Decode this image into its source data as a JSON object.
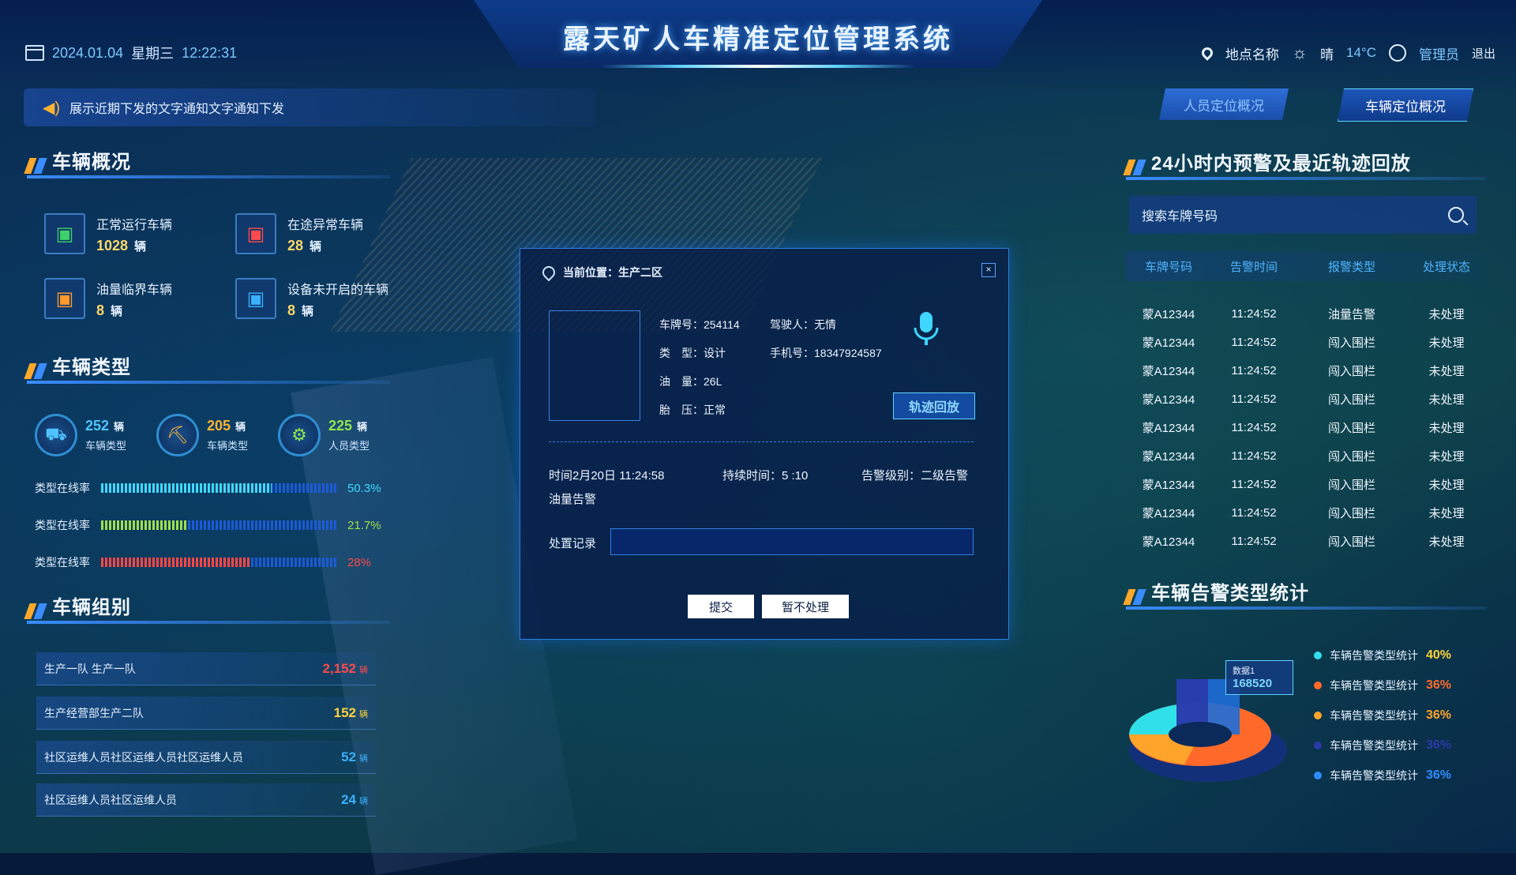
{
  "header": {
    "title": "露天矿人车精准定位管理系统",
    "date": "2024.01.04",
    "weekday": "星期三",
    "time": "12:22:31",
    "location": "地点名称",
    "weather": "晴",
    "temperature": "14°C",
    "user": "管理员",
    "logout": "退出"
  },
  "notice": {
    "text": "展示近期下发的文字通知文字通知下发"
  },
  "tabs": [
    {
      "label": "人员定位概况",
      "active": false
    },
    {
      "label": "车辆定位概况",
      "active": true
    }
  ],
  "overview": {
    "title": "车辆概况",
    "items": [
      {
        "label": "正常运行车辆",
        "value": "1028",
        "unit": "辆",
        "icon": "bus-green-icon",
        "color": "#3fd06a"
      },
      {
        "label": "在途异常车辆",
        "value": "28",
        "unit": "辆",
        "icon": "bus-red-icon",
        "color": "#ff4b4b"
      },
      {
        "label": "油量临界车辆",
        "value": "8",
        "unit": "辆",
        "icon": "bus-orange-icon",
        "color": "#ff9a2a"
      },
      {
        "label": "设备未开启的车辆",
        "value": "8",
        "unit": "辆",
        "icon": "bus-blue-icon",
        "color": "#3ab0ff"
      }
    ]
  },
  "types": {
    "title": "车辆类型",
    "items": [
      {
        "value": "252",
        "unit": "辆",
        "label": "车辆类型",
        "icon": "forklift-icon",
        "color": "#4fc3ff"
      },
      {
        "value": "205",
        "unit": "辆",
        "label": "车辆类型",
        "icon": "excavator-icon",
        "color": "#ffb432"
      },
      {
        "value": "225",
        "unit": "辆",
        "label": "人员类型",
        "icon": "loader-icon",
        "color": "#8fe64a"
      }
    ],
    "rates": [
      {
        "label": "类型在线率",
        "value": "50.3%",
        "pct": 0.724,
        "color": "#40d8ff"
      },
      {
        "label": "类型在线率",
        "value": "21.7%",
        "pct": 0.362,
        "color": "#9fe04a"
      },
      {
        "label": "类型在线率",
        "value": "28%",
        "pct": 0.638,
        "color": "#ff4646"
      }
    ]
  },
  "groups": {
    "title": "车辆组别",
    "unit": "辆",
    "items": [
      {
        "name": "生产一队 生产一队",
        "value": "2,152",
        "color": "#ff4b4b"
      },
      {
        "name": "生产经营部生产二队",
        "value": "152",
        "color": "#ffd23a"
      },
      {
        "name": "社区运维人员社区运维人员社区运维人员",
        "value": "52",
        "color": "#3ab0ff"
      },
      {
        "name": "社区运维人员社区运维人员",
        "value": "24",
        "color": "#3ab0ff"
      }
    ]
  },
  "alerts": {
    "title": "24小时内预警及最近轨迹回放",
    "search_placeholder": "搜索车牌号码",
    "columns": [
      "车牌号码",
      "告警时间",
      "报警类型",
      "处理状态"
    ],
    "rows": [
      [
        "蒙A12344",
        "11:24:52",
        "油量告警",
        "未处理"
      ],
      [
        "蒙A12344",
        "11:24:52",
        "闯入围栏",
        "未处理"
      ],
      [
        "蒙A12344",
        "11:24:52",
        "闯入围栏",
        "未处理"
      ],
      [
        "蒙A12344",
        "11:24:52",
        "闯入围栏",
        "未处理"
      ],
      [
        "蒙A12344",
        "11:24:52",
        "闯入围栏",
        "未处理"
      ],
      [
        "蒙A12344",
        "11:24:52",
        "闯入围栏",
        "未处理"
      ],
      [
        "蒙A12344",
        "11:24:52",
        "闯入围栏",
        "未处理"
      ],
      [
        "蒙A12344",
        "11:24:52",
        "闯入围栏",
        "未处理"
      ],
      [
        "蒙A12344",
        "11:24:52",
        "闯入围栏",
        "未处理"
      ]
    ]
  },
  "stats": {
    "title": "车辆告警类型统计",
    "tag_label": "数据1",
    "tag_value": "168520",
    "legend": [
      {
        "label": "车辆告警类型统计",
        "pct": "40%",
        "color": "#2fe0e8"
      },
      {
        "label": "车辆告警类型统计",
        "pct": "36%",
        "color": "#ff6a2a"
      },
      {
        "label": "车辆告警类型统计",
        "pct": "36%",
        "color": "#ffa42a"
      },
      {
        "label": "车辆告警类型统计",
        "pct": "36%",
        "color": "#2a3aa8"
      },
      {
        "label": "车辆告警类型统计",
        "pct": "36%",
        "color": "#2f8cff"
      }
    ]
  },
  "modal": {
    "location": "当前位置：生产二区",
    "plate": "车牌号：254114",
    "driver": "驾驶人：无情",
    "type": "类　型：设计",
    "phone": "手机号：18347924587",
    "fuel": "油　量：26L",
    "tire": "胎　压：正常",
    "replay": "轨迹回放",
    "alert_time": "时间2月20日 11:24:58",
    "duration": "持续时间：5 :10",
    "level": "告警级别：二级告警",
    "alert_type": "油量告警",
    "record_label": "处置记录",
    "submit": "提交",
    "later": "暂不处理",
    "close": "×"
  }
}
